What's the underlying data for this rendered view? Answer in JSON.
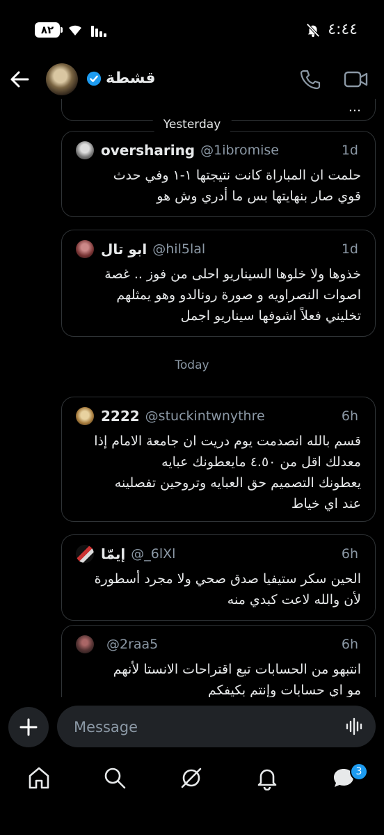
{
  "status_bar": {
    "battery": "٨٢",
    "time": "٤:٤٤"
  },
  "header": {
    "contact_name": "قشطة"
  },
  "chat": {
    "prev_fragment": "...",
    "date_yesterday": "Yesterday",
    "date_today": "Today",
    "messages": [
      {
        "name": "oversharing",
        "handle": "@1ibromise",
        "time": "1d",
        "text": "حلمت ان المباراة كانت نتيجتها ١-١ وفي حدث\nقوي صار بنهايتها بس ما أدري وش هو"
      },
      {
        "name": "ابو تال",
        "handle": "@hil5lal",
        "time": "1d",
        "text": "خذوها ولا خلوها السيناريو احلى من فوز .. غصة\nاصوات النصراويه و صورة رونالدو وهو يمثلهم\nتخليني فعلاً اشوفها سيناريو اجمل"
      },
      {
        "name": "2222",
        "handle": "@stuckintwnythre",
        "time": "6h",
        "text": "قسم بالله انصدمت يوم دريت ان جامعة الامام إذا\nمعدلك اقل من ٤.٥٠ مايعطونك عبايه\nيعطونك التصميم حق العبايه وتروحين تفصلينه\nعند اي خياط"
      },
      {
        "name": "إيمّا",
        "handle": "@_6lXl",
        "time": "6h",
        "text": "الحين سكر ستيفيا صدق صحي ولا مجرد أسطورة\nلأن والله لاعت كبدي منه"
      },
      {
        "name": "",
        "handle": "@2raa5",
        "time": "6h",
        "text": "انتبهو من الحسابات تبع اقتراحات الانستا لأنهم\nمو اي حسابات وإنتم بكيفكم"
      }
    ]
  },
  "composer": {
    "placeholder": "Message"
  },
  "nav": {
    "badge": "3"
  },
  "colors": {
    "background": "#000000",
    "accent": "#1d9bf0",
    "muted": "#8b98a5",
    "border": "#2f3336"
  }
}
